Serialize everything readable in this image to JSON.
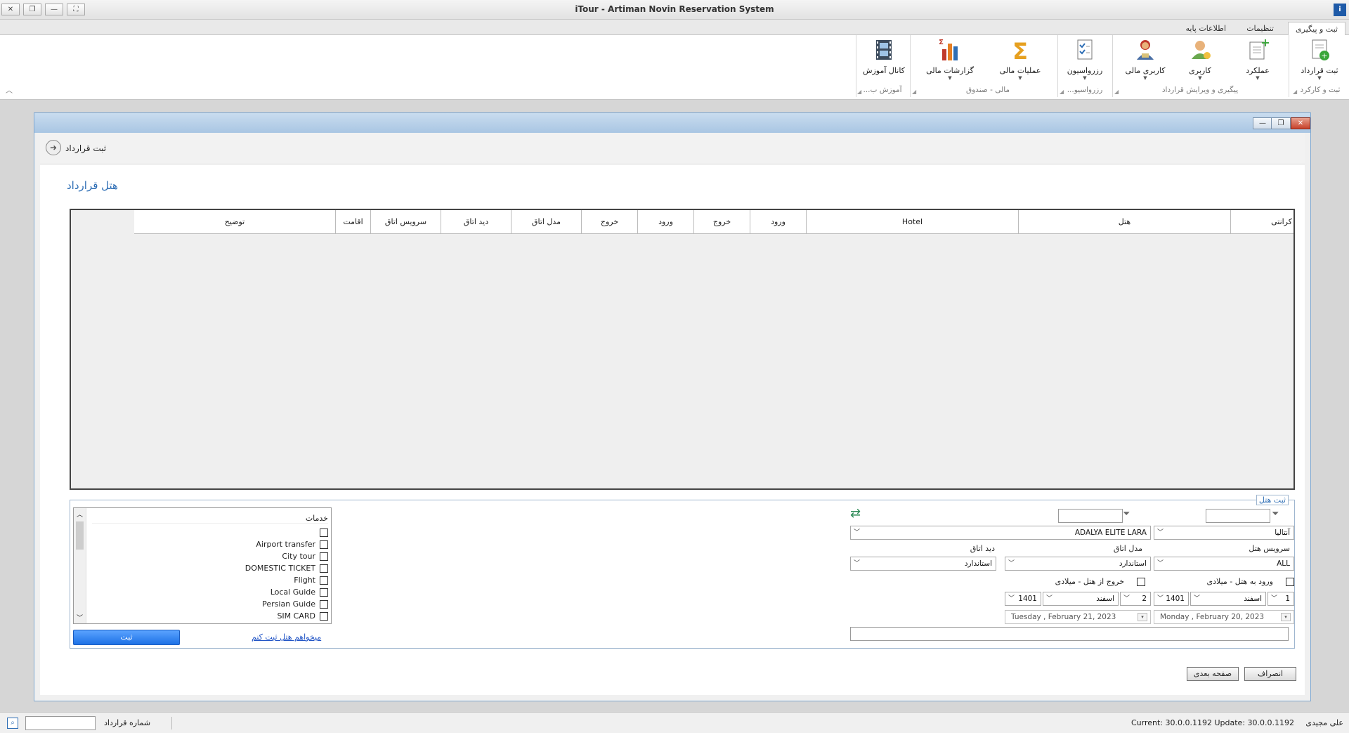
{
  "window": {
    "title": "iTour - Artiman Novin Reservation System"
  },
  "ribbon_tabs": [
    "ثبت و پیگیری",
    "تنظیمات",
    "اطلاعات پایه"
  ],
  "ribbon_groups": [
    {
      "label": "ثبت و کارکرد",
      "buttons": [
        {
          "label": "ثبت قرارداد",
          "icon": "document-add-icon"
        }
      ]
    },
    {
      "label": "پیگیری و ویرایش قرارداد",
      "buttons": [
        {
          "label": "عملکرد",
          "icon": "report-add-icon"
        },
        {
          "label": "کاربری",
          "icon": "user-icon"
        },
        {
          "label": "کاربری مالی",
          "icon": "user-finance-icon"
        }
      ]
    },
    {
      "label": "رزرواسیو...",
      "buttons": [
        {
          "label": "رزرواسیون",
          "icon": "checklist-icon"
        }
      ]
    },
    {
      "label": "مالی - صندوق",
      "buttons": [
        {
          "label": "عملیات مالی",
          "icon": "sigma-icon"
        },
        {
          "label": "گزارشات مالی",
          "icon": "bar-chart-icon"
        }
      ]
    },
    {
      "label": "آموزش ب...",
      "buttons": [
        {
          "label": "کانال آموزش",
          "icon": "film-icon"
        }
      ]
    }
  ],
  "form": {
    "header_title": "ثبت قرارداد",
    "section_title": "هتل قرارداد"
  },
  "grid": {
    "columns": [
      "کرانتی",
      "هتل",
      "Hotel",
      "ورود",
      "خروج",
      "ورود",
      "خروج",
      "مدل اتاق",
      "دید اتاق",
      "سرویس اتاق",
      "اقامت",
      "توضیح"
    ]
  },
  "hotel_form": {
    "legend": "ثبت هتل",
    "city_value": "آنتالیا",
    "hotel_value": "ADALYA ELITE LARA",
    "labels": {
      "hotel_service": "سرویس هتل",
      "room_model": "مدل اتاق",
      "room_view": "دید اتاق",
      "checkin_miladi": "ورود به هتل - میلادی",
      "checkout_miladi": "خروج از هتل - میلادی"
    },
    "hotel_service_value": "ALL",
    "room_model_value": "استاندارد",
    "room_view_value": "استاندارد",
    "checkin": {
      "day": "1",
      "month": "اسفند",
      "year": "1401",
      "date_display": "Monday   ,   February  20, 2023"
    },
    "checkout": {
      "day": "2",
      "month": "اسفند",
      "year": "1401",
      "date_display": "Tuesday   ,   February  21, 2023"
    }
  },
  "services": {
    "header": "خدمات",
    "items": [
      "",
      "Airport transfer",
      "City tour",
      "DOMESTIC TICKET",
      "Flight",
      "Local Guide",
      "Persian Guide",
      "SIM CARD"
    ]
  },
  "buttons": {
    "submit": "ثبت",
    "want_hotel_link": "میخواهم هتل ثبت کنم",
    "next_page": "صفحه بعدی",
    "cancel": "انصراف"
  },
  "statusbar": {
    "version": "Current: 30.0.0.1192 Update: 30.0.0.1192",
    "user": "علی مجیدی",
    "contract_label": "شماره قرارداد",
    "contract_value": ""
  },
  "colors": {
    "accent": "#2e6eb5",
    "mdi_title": "#a9c6e3",
    "submit_button": "#1c71e6"
  }
}
